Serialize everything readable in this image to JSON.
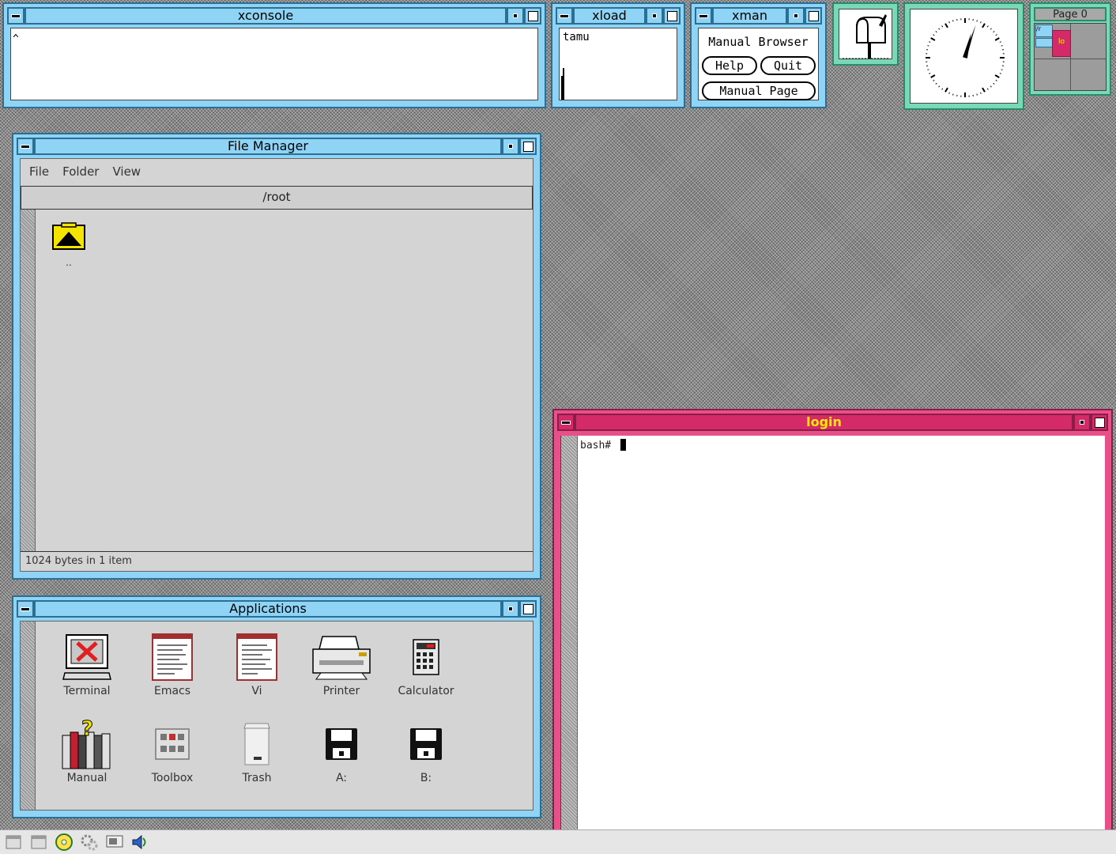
{
  "xconsole": {
    "title": "xconsole",
    "content": "^"
  },
  "xload": {
    "title": "xload",
    "host": "tamu"
  },
  "xman": {
    "title": "xman",
    "heading": "Manual Browser",
    "help": "Help",
    "quit": "Quit",
    "manual_page": "Manual Page"
  },
  "pager": {
    "title": "Page 0",
    "mini_labels": [
      "/r",
      "lo"
    ]
  },
  "file_manager": {
    "title": "File Manager",
    "menu": [
      "File",
      "Folder",
      "View"
    ],
    "path": "/root",
    "items": [
      {
        "name": ".."
      }
    ],
    "status": "1024 bytes in 1 item"
  },
  "applications": {
    "title": "Applications",
    "items": [
      "Terminal",
      "Emacs",
      "Vi",
      "Printer",
      "Calculator",
      "Manual",
      "Toolbox",
      "Trash",
      "A:",
      "B:"
    ]
  },
  "login": {
    "title": "login",
    "prompt": "bash#"
  },
  "colors": {
    "window_blue": "#8fd3f5",
    "window_teal": "#79d8b6",
    "login_red": "#d52a68",
    "login_title_text": "#ffea00"
  }
}
